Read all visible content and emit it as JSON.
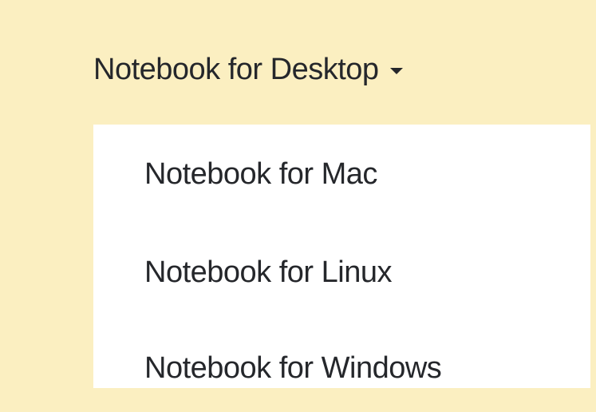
{
  "menu": {
    "trigger_label": "Notebook for Desktop",
    "caret_icon": "caret-down-icon",
    "items": [
      {
        "label": "Notebook for Mac"
      },
      {
        "label": "Notebook for Linux"
      },
      {
        "label": "Notebook for Windows"
      }
    ]
  },
  "colors": {
    "background": "#fbefc1",
    "panel": "#ffffff",
    "text": "#25272b"
  }
}
